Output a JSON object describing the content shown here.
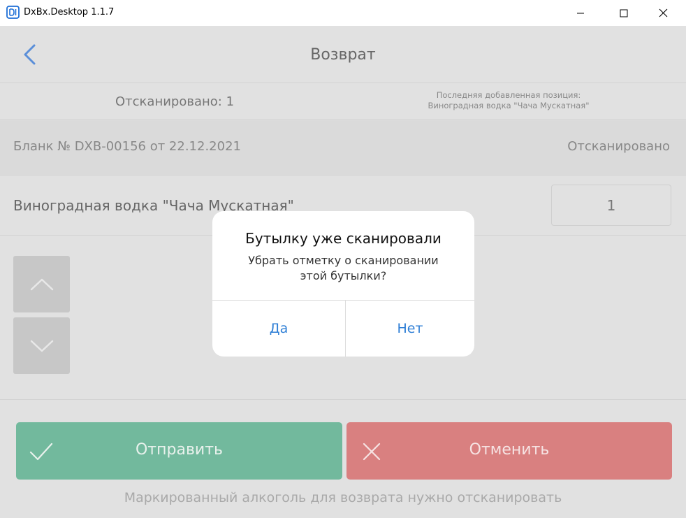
{
  "window": {
    "title": "DxBx.Desktop 1.1.7",
    "logo_icon": "dxbx-logo-icon",
    "minimize_icon": "minimize-icon",
    "maximize_icon": "maximize-icon",
    "close_icon": "close-icon"
  },
  "header": {
    "title": "Возврат",
    "back_icon": "chevron-left-icon"
  },
  "scan_info": {
    "scanned_count": "Отсканировано: 1",
    "last_added_label": "Последняя добавленная позиция:",
    "last_added_value": "Виноградная водка \"Чача Мускатная\""
  },
  "document": {
    "number": "Бланк № DXB-00156 от 22.12.2021",
    "status": "Отсканировано"
  },
  "items": [
    {
      "name": "Виноградная водка \"Чача Мускатная\"",
      "quantity": "1"
    }
  ],
  "footer": {
    "send_label": "Отправить",
    "cancel_label": "Отменить",
    "hint": "Маркированный алкоголь для возврата нужно отсканировать"
  },
  "dialog": {
    "title": "Бутылку уже сканировали",
    "message": "Убрать отметку о сканировании этой бутылки?",
    "yes_label": "Да",
    "no_label": "Нет"
  },
  "colors": {
    "accent": "#2f7fd6",
    "send": "#72b99d",
    "cancel": "#d98080"
  }
}
